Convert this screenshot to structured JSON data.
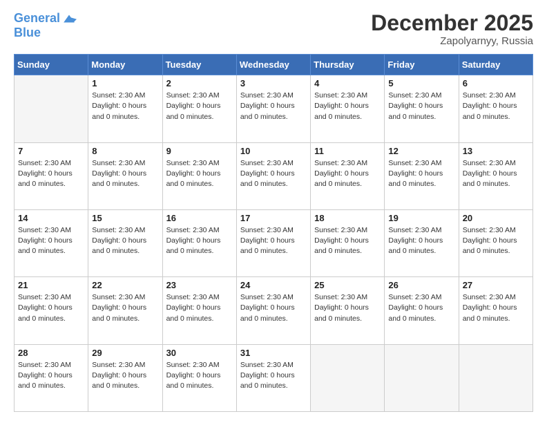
{
  "header": {
    "logo_line1": "General",
    "logo_line2": "Blue",
    "month_year": "December 2025",
    "location": "Zapolyarnyy, Russia"
  },
  "days_of_week": [
    "Sunday",
    "Monday",
    "Tuesday",
    "Wednesday",
    "Thursday",
    "Friday",
    "Saturday"
  ],
  "weeks": [
    [
      {
        "day": "",
        "empty": true
      },
      {
        "day": "1",
        "sunset": "Sunset: 2:30 AM",
        "daylight": "Daylight: 0 hours and 0 minutes."
      },
      {
        "day": "2",
        "sunset": "Sunset: 2:30 AM",
        "daylight": "Daylight: 0 hours and 0 minutes."
      },
      {
        "day": "3",
        "sunset": "Sunset: 2:30 AM",
        "daylight": "Daylight: 0 hours and 0 minutes."
      },
      {
        "day": "4",
        "sunset": "Sunset: 2:30 AM",
        "daylight": "Daylight: 0 hours and 0 minutes."
      },
      {
        "day": "5",
        "sunset": "Sunset: 2:30 AM",
        "daylight": "Daylight: 0 hours and 0 minutes."
      },
      {
        "day": "6",
        "sunset": "Sunset: 2:30 AM",
        "daylight": "Daylight: 0 hours and 0 minutes."
      }
    ],
    [
      {
        "day": "7",
        "sunset": "Sunset: 2:30 AM",
        "daylight": "Daylight: 0 hours and 0 minutes."
      },
      {
        "day": "8",
        "sunset": "Sunset: 2:30 AM",
        "daylight": "Daylight: 0 hours and 0 minutes."
      },
      {
        "day": "9",
        "sunset": "Sunset: 2:30 AM",
        "daylight": "Daylight: 0 hours and 0 minutes."
      },
      {
        "day": "10",
        "sunset": "Sunset: 2:30 AM",
        "daylight": "Daylight: 0 hours and 0 minutes."
      },
      {
        "day": "11",
        "sunset": "Sunset: 2:30 AM",
        "daylight": "Daylight: 0 hours and 0 minutes."
      },
      {
        "day": "12",
        "sunset": "Sunset: 2:30 AM",
        "daylight": "Daylight: 0 hours and 0 minutes."
      },
      {
        "day": "13",
        "sunset": "Sunset: 2:30 AM",
        "daylight": "Daylight: 0 hours and 0 minutes."
      }
    ],
    [
      {
        "day": "14",
        "sunset": "Sunset: 2:30 AM",
        "daylight": "Daylight: 0 hours and 0 minutes."
      },
      {
        "day": "15",
        "sunset": "Sunset: 2:30 AM",
        "daylight": "Daylight: 0 hours and 0 minutes."
      },
      {
        "day": "16",
        "sunset": "Sunset: 2:30 AM",
        "daylight": "Daylight: 0 hours and 0 minutes."
      },
      {
        "day": "17",
        "sunset": "Sunset: 2:30 AM",
        "daylight": "Daylight: 0 hours and 0 minutes."
      },
      {
        "day": "18",
        "sunset": "Sunset: 2:30 AM",
        "daylight": "Daylight: 0 hours and 0 minutes."
      },
      {
        "day": "19",
        "sunset": "Sunset: 2:30 AM",
        "daylight": "Daylight: 0 hours and 0 minutes."
      },
      {
        "day": "20",
        "sunset": "Sunset: 2:30 AM",
        "daylight": "Daylight: 0 hours and 0 minutes."
      }
    ],
    [
      {
        "day": "21",
        "sunset": "Sunset: 2:30 AM",
        "daylight": "Daylight: 0 hours and 0 minutes."
      },
      {
        "day": "22",
        "sunset": "Sunset: 2:30 AM",
        "daylight": "Daylight: 0 hours and 0 minutes."
      },
      {
        "day": "23",
        "sunset": "Sunset: 2:30 AM",
        "daylight": "Daylight: 0 hours and 0 minutes."
      },
      {
        "day": "24",
        "sunset": "Sunset: 2:30 AM",
        "daylight": "Daylight: 0 hours and 0 minutes."
      },
      {
        "day": "25",
        "sunset": "Sunset: 2:30 AM",
        "daylight": "Daylight: 0 hours and 0 minutes."
      },
      {
        "day": "26",
        "sunset": "Sunset: 2:30 AM",
        "daylight": "Daylight: 0 hours and 0 minutes."
      },
      {
        "day": "27",
        "sunset": "Sunset: 2:30 AM",
        "daylight": "Daylight: 0 hours and 0 minutes."
      }
    ],
    [
      {
        "day": "28",
        "sunset": "Sunset: 2:30 AM",
        "daylight": "Daylight: 0 hours and 0 minutes."
      },
      {
        "day": "29",
        "sunset": "Sunset: 2:30 AM",
        "daylight": "Daylight: 0 hours and 0 minutes."
      },
      {
        "day": "30",
        "sunset": "Sunset: 2:30 AM",
        "daylight": "Daylight: 0 hours and 0 minutes."
      },
      {
        "day": "31",
        "sunset": "Sunset: 2:30 AM",
        "daylight": "Daylight: 0 hours and 0 minutes."
      },
      {
        "day": "",
        "empty": true
      },
      {
        "day": "",
        "empty": true
      },
      {
        "day": "",
        "empty": true
      }
    ]
  ]
}
